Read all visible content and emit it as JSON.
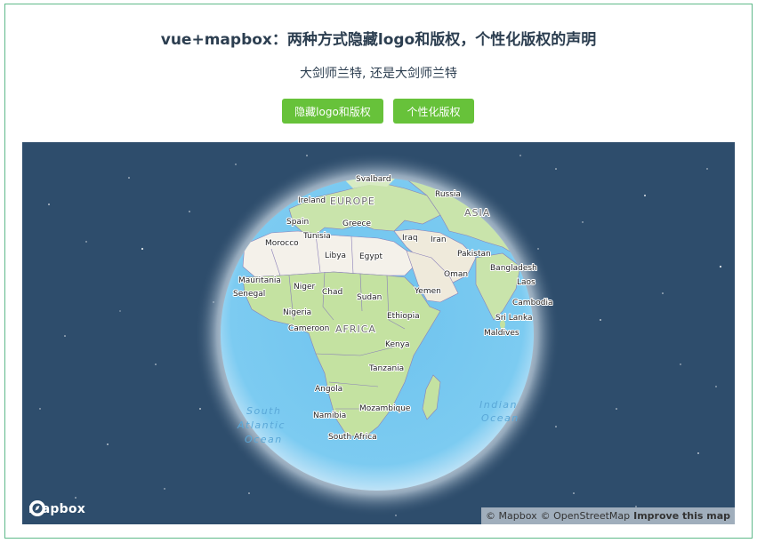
{
  "header": {
    "title": "vue+mapbox：两种方式隐藏logo和版权，个性化版权的声明",
    "subtitle": "大剑师兰特, 还是大剑师兰特"
  },
  "buttons": {
    "hide_logo_label": "隐藏logo和版权",
    "custom_copyright_label": "个性化版权"
  },
  "map": {
    "labels": {
      "svalbard": "Svalbard",
      "russia": "Russia",
      "ireland": "Ireland",
      "europe": "EUROPE",
      "asia": "ASIA",
      "spain": "Spain",
      "greece": "Greece",
      "tunisia": "Tunisia",
      "iraq": "Iraq",
      "iran": "Iran",
      "morocco": "Morocco",
      "libya": "Libya",
      "egypt": "Egypt",
      "pakistan": "Pakistan",
      "bangladesh": "Bangladesh",
      "oman": "Oman",
      "laos": "Laos",
      "mauritania": "Mauritania",
      "niger": "Niger",
      "senegal": "Senegal",
      "chad": "Chad",
      "sudan": "Sudan",
      "yemen": "Yemen",
      "cambodia": "Cambodia",
      "nigeria": "Nigeria",
      "ethiopia": "Ethiopia",
      "sri_lanka": "Sri Lanka",
      "cameroon": "Cameroon",
      "africa": "AFRICA",
      "maldives": "Maldives",
      "kenya": "Kenya",
      "tanzania": "Tanzania",
      "angola": "Angola",
      "mozambique": "Mozambique",
      "namibia": "Namibia",
      "south_africa": "South Africa",
      "south_atlantic_1": "South",
      "south_atlantic_2": "Atlantic",
      "south_atlantic_3": "Ocean",
      "indian_1": "Indian",
      "indian_2": "Ocean"
    },
    "logo_text": "mapbox",
    "attribution": {
      "mapbox": "© Mapbox",
      "osm": "© OpenStreetMap",
      "improve": "Improve this map"
    },
    "colors": {
      "space": "#2e4d6c",
      "ocean": "#72c6ef",
      "land": "#c7e3a8",
      "desert": "#f4f1ea",
      "border": "#8a7fb8",
      "button": "#67c23a"
    }
  }
}
